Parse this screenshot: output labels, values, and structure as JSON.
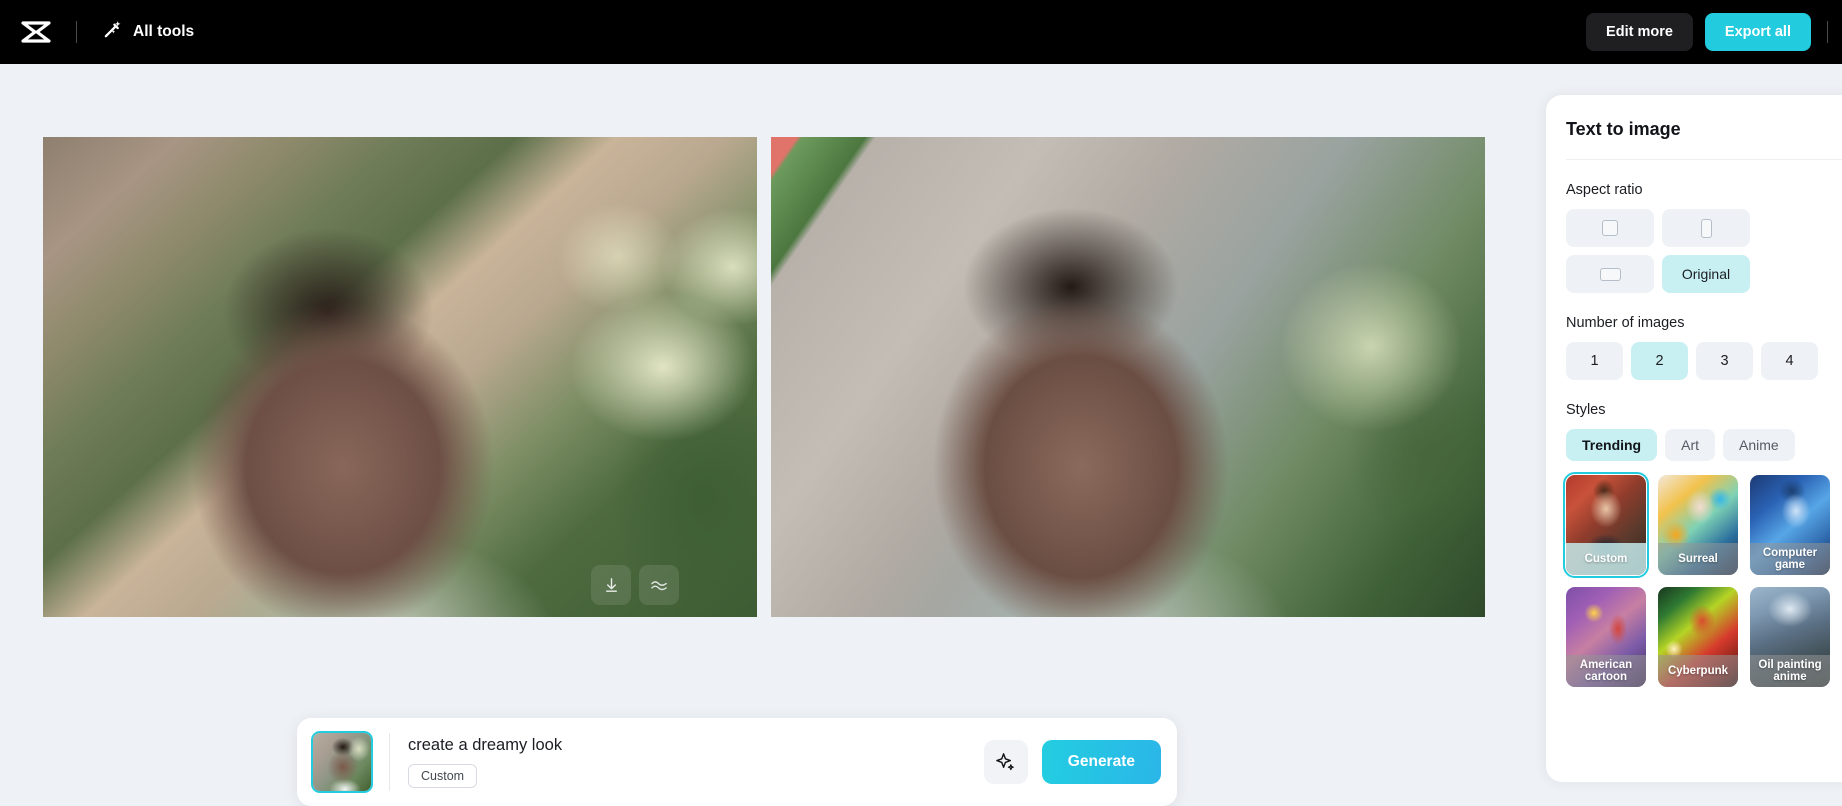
{
  "topbar": {
    "logo_icon": "capcut-logo-icon",
    "all_tools_label": "All tools",
    "all_tools_icon": "magic-wand-icon",
    "edit_more_label": "Edit more",
    "export_all_label": "Export all",
    "export_all_color": "#22ccde"
  },
  "canvas": {
    "images": [
      {
        "alt": "generated-image-1",
        "download_icon": "download-icon",
        "enhance_icon": "wave-enhance-icon"
      },
      {
        "alt": "generated-image-2"
      }
    ]
  },
  "prompt_bar": {
    "thumbnail_name": "source-image-thumbnail",
    "prompt_text": "create a dreamy look",
    "style_tag": "Custom",
    "sparkle_icon": "sparkle-icon",
    "generate_label": "Generate",
    "generate_color": "#23cde0"
  },
  "panel": {
    "title": "Text to image",
    "aspect_ratio": {
      "label": "Aspect ratio",
      "options": [
        {
          "label": "",
          "icon": "square-ratio-icon",
          "selected": false
        },
        {
          "label": "",
          "icon": "portrait-ratio-icon",
          "selected": false
        },
        {
          "label": "",
          "icon": "landscape-ratio-icon",
          "selected": false
        },
        {
          "label": "Original",
          "icon": "",
          "selected": true
        }
      ]
    },
    "number_of_images": {
      "label": "Number of images",
      "options": [
        "1",
        "2",
        "3",
        "4"
      ],
      "selected": "2"
    },
    "styles": {
      "label": "Styles",
      "tabs": [
        {
          "label": "Trending",
          "selected": true
        },
        {
          "label": "Art",
          "selected": false
        },
        {
          "label": "Anime",
          "selected": false
        }
      ],
      "cards": [
        {
          "label": "Custom",
          "selected": true
        },
        {
          "label": "Surreal",
          "selected": false
        },
        {
          "label": "Computer game",
          "selected": false
        },
        {
          "label": "American cartoon",
          "selected": false
        },
        {
          "label": "Cyberpunk",
          "selected": false
        },
        {
          "label": "Oil painting anime",
          "selected": false
        }
      ]
    }
  },
  "colors": {
    "accent": "#22ccde",
    "selected_chip": "#c8f0f2",
    "chip": "#eef1f5",
    "background": "#eef1f5",
    "topbar": "#000000"
  }
}
